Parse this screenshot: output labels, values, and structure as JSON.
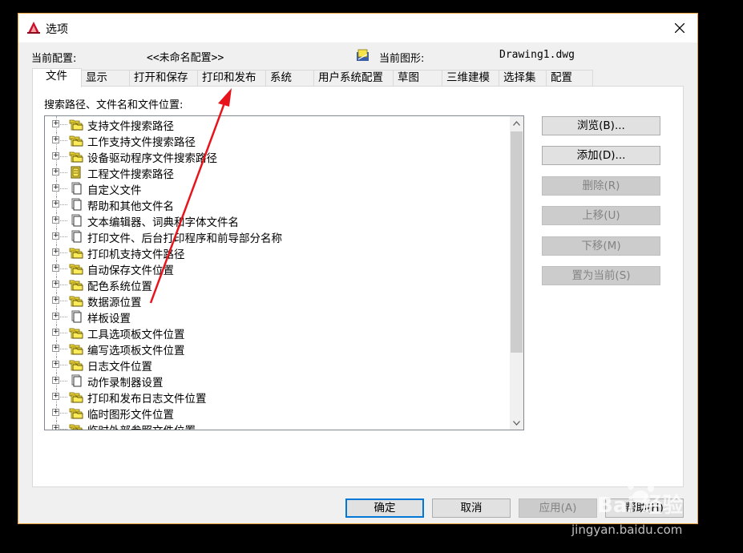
{
  "window": {
    "title": "选项",
    "close_icon": "close-icon",
    "app_icon": "autocad-logo-icon"
  },
  "header": {
    "profile_label": "当前配置:",
    "profile_value": "<<未命名配置>>",
    "drawing_label": "当前图形:",
    "drawing_value": "Drawing1.dwg"
  },
  "tabs": [
    "文件",
    "显示",
    "打开和保存",
    "打印和发布",
    "系统",
    "用户系统配置",
    "草图",
    "三维建模",
    "选择集",
    "配置"
  ],
  "active_tab": "文件",
  "tree": {
    "label": "搜索路径、文件名和文件位置:",
    "items": [
      {
        "label": "支持文件搜索路径",
        "icon": "folder-stack-icon"
      },
      {
        "label": "工作支持文件搜索路径",
        "icon": "folder-stack-icon"
      },
      {
        "label": "设备驱动程序文件搜索路径",
        "icon": "folder-stack-icon"
      },
      {
        "label": "工程文件搜索路径",
        "icon": "project-file-icon"
      },
      {
        "label": "自定义文件",
        "icon": "document-stack-icon"
      },
      {
        "label": "帮助和其他文件名",
        "icon": "document-stack-icon"
      },
      {
        "label": "文本编辑器、词典和字体文件名",
        "icon": "document-stack-icon"
      },
      {
        "label": "打印文件、后台打印程序和前导部分名称",
        "icon": "document-stack-icon"
      },
      {
        "label": "打印机支持文件路径",
        "icon": "folder-stack-icon"
      },
      {
        "label": "自动保存文件位置",
        "icon": "folder-stack-icon"
      },
      {
        "label": "配色系统位置",
        "icon": "folder-stack-icon"
      },
      {
        "label": "数据源位置",
        "icon": "folder-stack-icon"
      },
      {
        "label": "样板设置",
        "icon": "document-stack-icon"
      },
      {
        "label": "工具选项板文件位置",
        "icon": "folder-stack-icon"
      },
      {
        "label": "编写选项板文件位置",
        "icon": "folder-stack-icon"
      },
      {
        "label": "日志文件位置",
        "icon": "folder-stack-icon"
      },
      {
        "label": "动作录制器设置",
        "icon": "document-stack-icon"
      },
      {
        "label": "打印和发布日志文件位置",
        "icon": "folder-stack-icon"
      },
      {
        "label": "临时图形文件位置",
        "icon": "folder-stack-icon"
      },
      {
        "label": "临时外部参照文件位置",
        "icon": "folder-stack-icon"
      }
    ]
  },
  "side_buttons": [
    {
      "label": "浏览(B)...",
      "enabled": true
    },
    {
      "label": "添加(D)...",
      "enabled": true
    },
    {
      "label": "删除(R)",
      "enabled": false
    },
    {
      "label": "上移(U)",
      "enabled": false
    },
    {
      "label": "下移(M)",
      "enabled": false
    },
    {
      "label": "置为当前(S)",
      "enabled": false
    }
  ],
  "bottom_buttons": [
    {
      "label": "确定",
      "enabled": true,
      "default": true
    },
    {
      "label": "取消",
      "enabled": true,
      "default": false
    },
    {
      "label": "应用(A)",
      "enabled": false,
      "default": false
    },
    {
      "label": "帮助(H)",
      "enabled": true,
      "default": false
    }
  ],
  "annotation": {
    "type": "red-arrow",
    "color": "#e8141b"
  },
  "watermark": {
    "brand": "Bai 经验",
    "url": "jingyan.baidu.com"
  },
  "colors": {
    "folder": "#f7e34a",
    "accent": "#0078d7",
    "arrow": "#e8141b"
  }
}
